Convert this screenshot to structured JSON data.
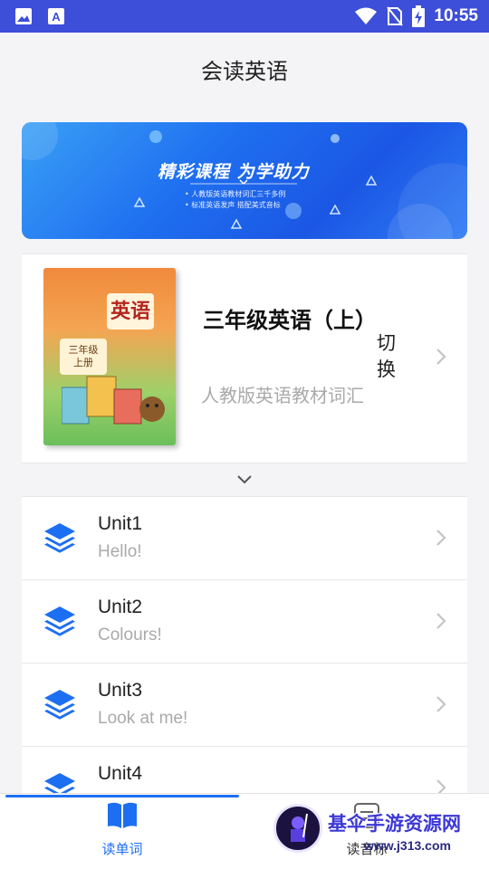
{
  "status_bar": {
    "time": "10:55",
    "icons": [
      "image-icon",
      "font-a-icon",
      "wifi-icon",
      "no-sim-icon",
      "battery-charging-icon"
    ]
  },
  "header": {
    "title": "会读英语"
  },
  "banner": {
    "headline": "精彩课程 为学助力",
    "lines": [
      "• 人教版英语教材词汇三千多例",
      "• 标准英语发声  搭配美式音标"
    ]
  },
  "book": {
    "cover": {
      "title": "英语",
      "grade": "三年级",
      "volume": "上册"
    },
    "title": "三年级英语（上）",
    "description": "人教版英语教材词汇",
    "switch_label": "切换"
  },
  "units": [
    {
      "name": "Unit1",
      "subtitle": "Hello!"
    },
    {
      "name": "Unit2",
      "subtitle": "Colours!"
    },
    {
      "name": "Unit3",
      "subtitle": "Look at me!"
    },
    {
      "name": "Unit4",
      "subtitle": ""
    }
  ],
  "bottom_nav": {
    "tabs": [
      {
        "label": "读单词",
        "active": true
      },
      {
        "label": "读音标",
        "active": false
      }
    ]
  },
  "watermark": {
    "name": "基伞手游资源网",
    "url": "www.j313.com"
  },
  "colors": {
    "accent": "#1d6ff2",
    "status_bar": "#3d4ed8"
  }
}
